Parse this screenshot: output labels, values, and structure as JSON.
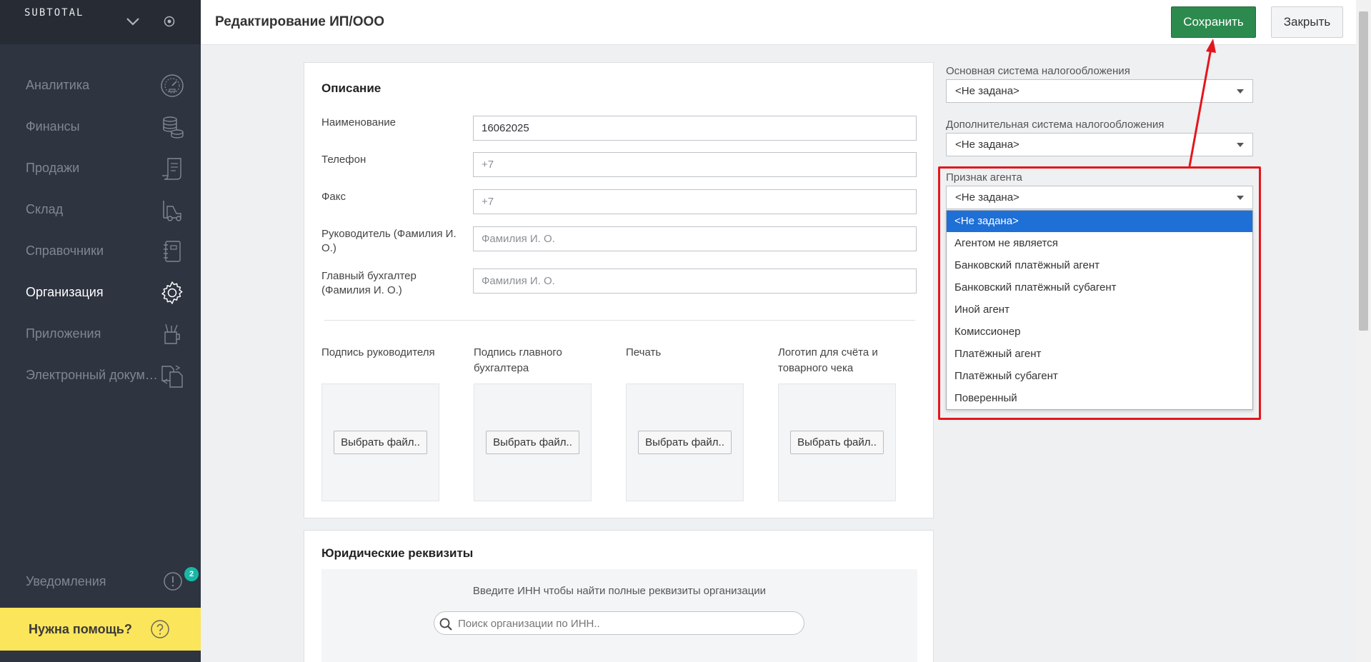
{
  "app": {
    "logo": "SUBTOTAL"
  },
  "sidebar": {
    "items": [
      {
        "label": "Аналитика",
        "icon": "speedometer-icon",
        "active": false
      },
      {
        "label": "Финансы",
        "icon": "coins-icon",
        "active": false
      },
      {
        "label": "Продажи",
        "icon": "receipt-icon",
        "active": false
      },
      {
        "label": "Склад",
        "icon": "forklift-icon",
        "active": false
      },
      {
        "label": "Справочники",
        "icon": "notebook-icon",
        "active": false
      },
      {
        "label": "Организация",
        "icon": "gear-icon",
        "active": true
      },
      {
        "label": "Приложения",
        "icon": "apps-cup-icon",
        "active": false
      },
      {
        "label": "Электронный документооборот",
        "icon": "documents-exchange-icon",
        "active": false
      }
    ],
    "notifications": {
      "label": "Уведомления",
      "count": "2"
    },
    "help": {
      "label": "Нужна помощь?"
    }
  },
  "header": {
    "title": "Редактирование ИП/ООО",
    "save_label": "Сохранить",
    "close_label": "Закрыть"
  },
  "description": {
    "title": "Описание",
    "fields": {
      "name": {
        "label": "Наименование",
        "value": "16062025"
      },
      "phone": {
        "label": "Телефон",
        "placeholder": "+7"
      },
      "fax": {
        "label": "Факс",
        "placeholder": "+7"
      },
      "director": {
        "label": "Руководитель (Фамилия И. О.)",
        "placeholder": "Фамилия И. О."
      },
      "accountant": {
        "label": "Главный бухгалтер (Фамилия И. О.)",
        "placeholder": "Фамилия И. О."
      }
    },
    "uploads": [
      {
        "label": "Подпись руководителя",
        "button": "Выбрать файл.."
      },
      {
        "label": "Подпись главного бухгалтера",
        "button": "Выбрать файл.."
      },
      {
        "label": "Печать",
        "button": "Выбрать файл.."
      },
      {
        "label": "Логотип для счёта и товарного чека",
        "button": "Выбрать файл.."
      }
    ]
  },
  "legal": {
    "title": "Юридические реквизиты",
    "hint": "Введите ИНН чтобы найти полные реквизиты организации",
    "search_placeholder": "Поиск организации по ИНН.."
  },
  "tax": {
    "main": {
      "label": "Основная система налогообложения",
      "value": "<Не задана>"
    },
    "additional": {
      "label": "Дополнительная система налогообложения",
      "value": "<Не задана>"
    },
    "agent": {
      "label": "Признак агента",
      "value": "<Не задана>",
      "options": [
        "<Не задана>",
        "Агентом не является",
        "Банковский платёжный агент",
        "Банковский платёжный субагент",
        "Иной агент",
        "Комиссионер",
        "Платёжный агент",
        "Платёжный субагент",
        "Поверенный"
      ],
      "selected_index": 0
    }
  },
  "colors": {
    "sidebar_bg": "#2e3440",
    "save_button": "#2d8a4e",
    "help_bg": "#fbe55a",
    "selection": "#1e6fd6",
    "annotation": "#e4161c",
    "badge": "#17b9a6"
  }
}
